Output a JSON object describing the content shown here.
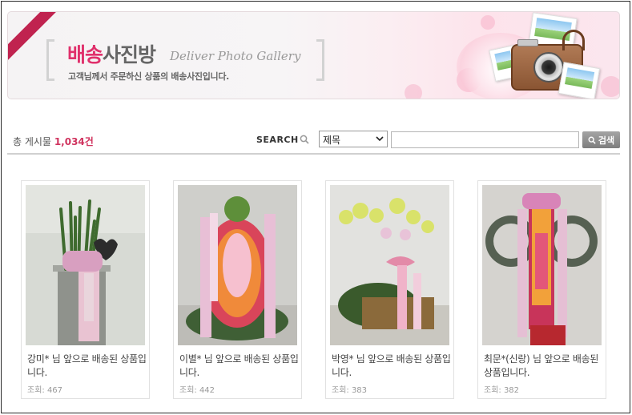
{
  "banner": {
    "title_highlight": "배송",
    "title_rest": "사진방",
    "subtitle_en": "Deliver Photo Gallery",
    "description": "고객님께서 주문하신 상품의 배송사진입니다."
  },
  "toolbar": {
    "count_label": "총 게시물",
    "count_value": "1,034건",
    "search_label": "SEARCH",
    "select_value": "제목",
    "search_value": "",
    "search_button": "검색"
  },
  "gallery": [
    {
      "caption": "강미* 님 앞으로 배송된 상품입니다.",
      "views": "조회: 467"
    },
    {
      "caption": "이별* 님 앞으로 배송된 상품입니다.",
      "views": "조회: 442"
    },
    {
      "caption": "박영* 님 앞으로 배송된 상품입니다.",
      "views": "조회: 383"
    },
    {
      "caption": "최문*(신랑) 님 앞으로 배송된 상품입니다.",
      "views": "조회: 382"
    }
  ],
  "colors": {
    "accent": "#e0306b",
    "count": "#d0345f",
    "button": "#8e8e8e"
  }
}
